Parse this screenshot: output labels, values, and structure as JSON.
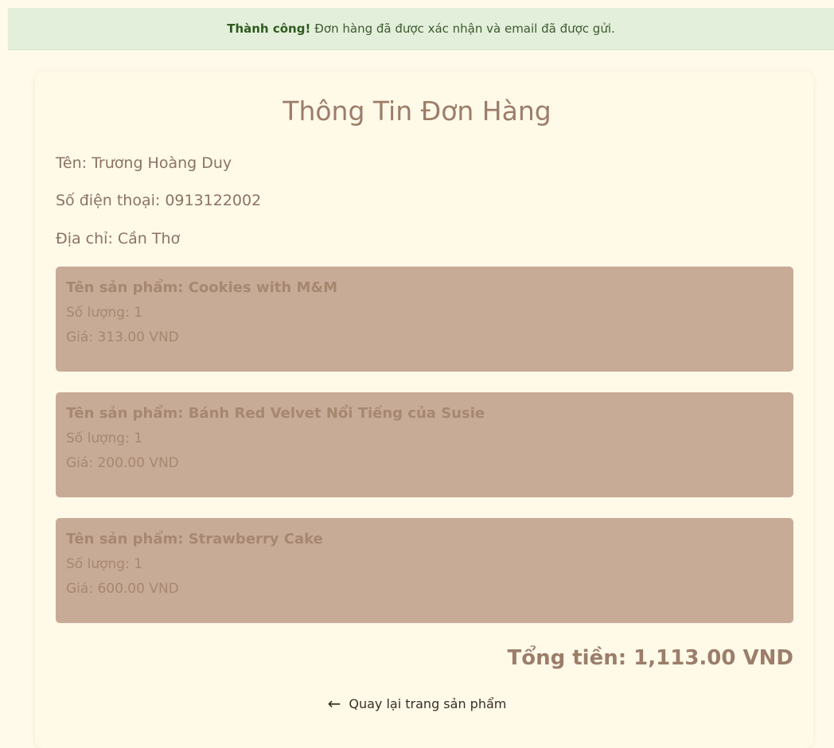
{
  "alert": {
    "strong": "Thành công!",
    "message": "Đơn hàng đã được xác nhận và email đã được gửi."
  },
  "order": {
    "title": "Thông Tin Đơn Hàng",
    "name": "Tên: Trương Hoàng Duy",
    "phone": "Số điện thoại: 0913122002",
    "address": "Địa chỉ: Cần Thơ",
    "items": [
      {
        "name": "Tên sản phẩm: Cookies with M&M",
        "quantity": "Số lượng: 1",
        "price": "Giá: 313.00 VND"
      },
      {
        "name": "Tên sản phẩm: Bánh Red Velvet Nổi Tiếng của Susie",
        "quantity": "Số lượng: 1",
        "price": "Giá: 200.00 VND"
      },
      {
        "name": "Tên sản phẩm: Strawberry Cake",
        "quantity": "Số lượng: 1",
        "price": "Giá: 600.00 VND"
      }
    ],
    "total": "Tổng tiền: 1,113.00 VND"
  },
  "back_link": {
    "icon": "arrow-left-icon",
    "label": "Quay lại trang sản phẩm"
  },
  "colors": {
    "page_background": "#fffaea",
    "alert_background": "#e3efdb",
    "item_background": "#c8ab97",
    "title_color": "#9c7d69"
  }
}
